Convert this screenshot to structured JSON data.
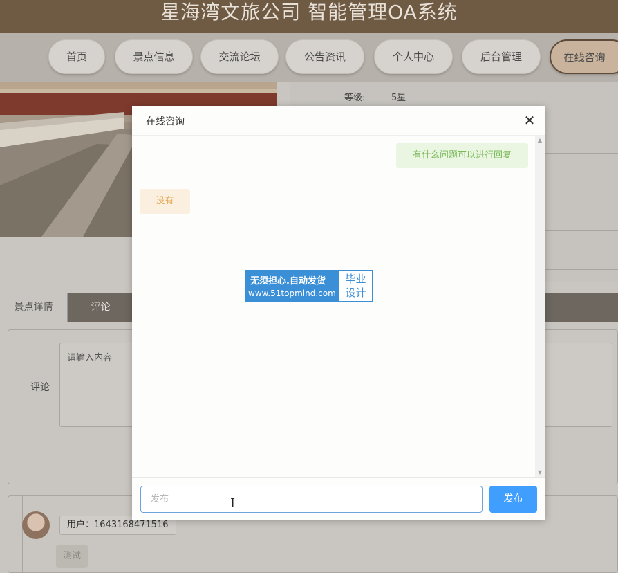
{
  "site": {
    "title": "星海湾文旅公司 智能管理OA系统"
  },
  "nav": {
    "items": [
      {
        "label": "首页"
      },
      {
        "label": "景点信息"
      },
      {
        "label": "交流论坛"
      },
      {
        "label": "公告资讯"
      },
      {
        "label": "个人中心"
      },
      {
        "label": "后台管理"
      },
      {
        "label": "在线咨询",
        "active": true
      }
    ]
  },
  "details": {
    "level_label": "等级:",
    "level_value": "5星"
  },
  "tabs": {
    "active": "景点详情",
    "other": "评论"
  },
  "comment": {
    "label": "评论",
    "placeholder": "请输入内容"
  },
  "comments_list": {
    "user": "用户：1643168471516",
    "test_button": "测试"
  },
  "modal": {
    "title": "在线咨询",
    "close_icon": "close-icon",
    "messages": [
      {
        "side": "right",
        "text": "有什么问题可以进行回复"
      },
      {
        "side": "left",
        "text": "没有"
      }
    ],
    "input_placeholder": "发布",
    "send_label": "发布"
  },
  "watermark": {
    "line1": "无须担心.自动发货",
    "line2": "www.51topmind.com",
    "right": "毕业设计"
  },
  "colors": {
    "accent": "#409eff",
    "header_bg": "#6f5a44",
    "user_bubble": "#eaf6e2",
    "admin_bubble": "#fbf0e0"
  }
}
